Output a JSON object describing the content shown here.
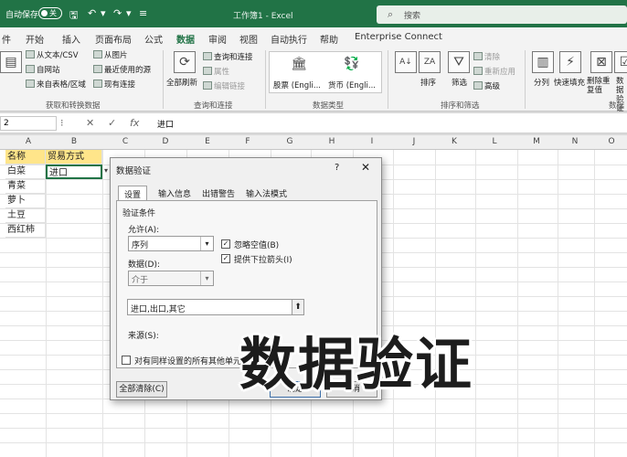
{
  "titlebar": {
    "autosave": "自动保存",
    "toggle": "关",
    "doc_title": "工作簿1 - Excel",
    "search_placeholder": "搜索"
  },
  "menu": [
    "件",
    "开始",
    "插入",
    "页面布局",
    "公式",
    "数据",
    "审阅",
    "视图",
    "自动执行",
    "帮助",
    "Enterprise Connect"
  ],
  "ribbon": {
    "get_data": {
      "from_text_csv": "从文本/CSV",
      "from_web": "自网站",
      "from_table": "来自表格/区域",
      "from_picture": "从图片",
      "recent_sources": "最近使用的源",
      "existing_connections": "现有连接",
      "group_label": "获取和转换数据"
    },
    "queries": {
      "refresh_all": "全部刷新",
      "queries_connections": "查询和连接",
      "properties": "属性",
      "edit_links": "编辑链接",
      "group_label": "查询和连接"
    },
    "data_types": {
      "stocks": "股票 (Engli...",
      "currencies": "货币 (Engli...",
      "group_label": "数据类型"
    },
    "sort_filter": {
      "sort": "排序",
      "filter": "筛选",
      "clear": "清除",
      "reapply": "重新应用",
      "advanced": "高级",
      "group_label": "排序和筛选"
    },
    "tools": {
      "split": "分列",
      "flash_fill": "快速填充",
      "remove_dup": "删除重复值",
      "validate": "数据验证",
      "group_label": "数据"
    }
  },
  "formula_bar": {
    "name_box": "2",
    "value": "进口"
  },
  "columns": [
    "A",
    "B",
    "C",
    "D",
    "E",
    "F",
    "G",
    "H",
    "I",
    "J",
    "K",
    "L",
    "M",
    "N",
    "O"
  ],
  "cells": {
    "a1": "名称",
    "b1": "贸易方式",
    "b2": "进口",
    "a2": "白菜",
    "a3": "青菜",
    "a4": "萝卜",
    "a5": "土豆",
    "a6": "西红柿"
  },
  "dialog": {
    "title": "数据验证",
    "help": "?",
    "close": "✕",
    "tabs": [
      "设置",
      "输入信息",
      "出错警告",
      "输入法模式"
    ],
    "criteria_label": "验证条件",
    "allow_label": "允许(A):",
    "allow_value": "序列",
    "data_label": "数据(D):",
    "data_value": "介于",
    "ignore_blank": "忽略空值(B)",
    "dropdown": "提供下拉箭头(I)",
    "source_label": "来源(S):",
    "source_value": "进口,出口,其它",
    "apply_all": "对有同样设置的所有其他单元格",
    "clear_all": "全部清除(C)",
    "ok": "确定",
    "cancel": "取消"
  },
  "overlay_text": "数据验证"
}
